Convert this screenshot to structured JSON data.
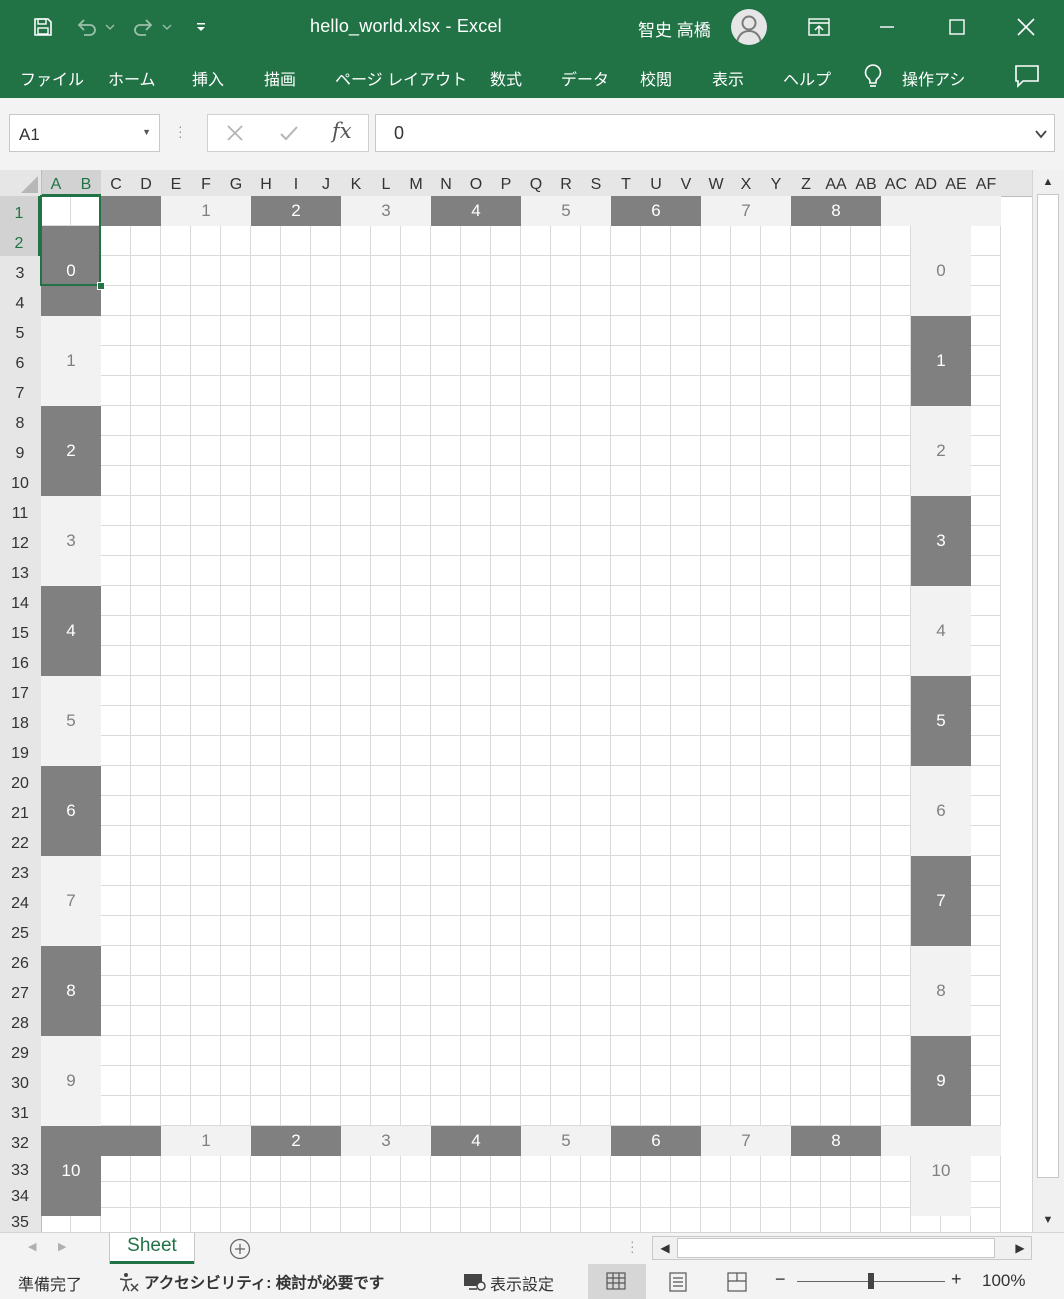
{
  "titlebar": {
    "title": "hello_world.xlsx  -  Excel",
    "user_name": "智史 高橋",
    "icons": [
      "save-icon",
      "undo-icon",
      "redo-icon",
      "customize-qat-icon",
      "ribbon-display-icon",
      "minimize-icon",
      "maximize-icon",
      "close-icon"
    ]
  },
  "menu": {
    "items": [
      "ファイル",
      "ホーム",
      "挿入",
      "描画",
      "ページ レイアウト",
      "数式",
      "データ",
      "校閲",
      "表示",
      "ヘルプ",
      "操作アシ"
    ],
    "comment_icon": "comment-icon",
    "lightbulb_icon": "lightbulb-icon"
  },
  "formula_bar": {
    "name_box": "A1",
    "value": "0",
    "fx_label": "fx"
  },
  "grid": {
    "columns": [
      "A",
      "B",
      "C",
      "D",
      "E",
      "F",
      "G",
      "H",
      "I",
      "J",
      "K",
      "L",
      "M",
      "N",
      "O",
      "P",
      "Q",
      "R",
      "S",
      "T",
      "U",
      "V",
      "W",
      "X",
      "Y",
      "Z",
      "AA",
      "AB",
      "AC",
      "AD",
      "AE",
      "AF"
    ],
    "rows": [
      "1",
      "2",
      "3",
      "4",
      "5",
      "6",
      "7",
      "8",
      "9",
      "10",
      "11",
      "12",
      "13",
      "14",
      "15",
      "16",
      "17",
      "18",
      "19",
      "20",
      "21",
      "22",
      "23",
      "24",
      "25",
      "26",
      "27",
      "28",
      "29",
      "30",
      "31",
      "32",
      "33",
      "34",
      "35"
    ],
    "selected_cell": "A1",
    "top_band": [
      "",
      "1",
      "2",
      "3",
      "4",
      "5",
      "6",
      "7",
      "8",
      ""
    ],
    "bottom_band": [
      "",
      "1",
      "2",
      "3",
      "4",
      "5",
      "6",
      "7",
      "8",
      ""
    ],
    "left_column": [
      "0",
      "1",
      "2",
      "3",
      "4",
      "5",
      "6",
      "7",
      "8",
      "9",
      "10"
    ],
    "right_column": [
      "0",
      "1",
      "2",
      "3",
      "4",
      "5",
      "6",
      "7",
      "8",
      "9",
      "10"
    ],
    "colors": {
      "dark": "#808080",
      "light": "#f2f2f2",
      "dark_text": "#ffffff",
      "light_text": "#808080"
    }
  },
  "sheet_tabs": {
    "active": "Sheet",
    "add_icon": "add-sheet-icon"
  },
  "status_bar": {
    "ready": "準備完了",
    "accessibility": "アクセシビリティ: 検討が必要です",
    "display_settings": "表示設定",
    "zoom_minus": "−",
    "zoom_plus": "+",
    "zoom_level": "100%",
    "zoom_fraction": 0.5
  },
  "accent_color": "#217346"
}
